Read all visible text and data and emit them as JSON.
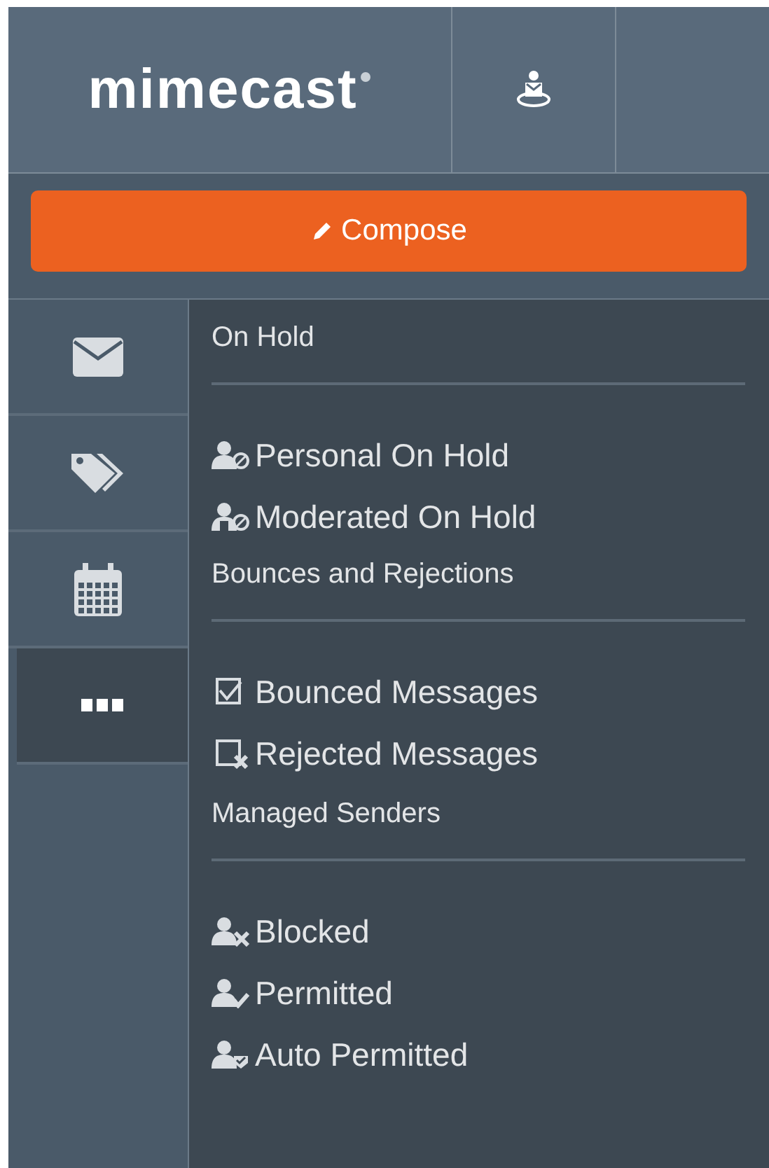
{
  "header": {
    "logo": "mimecast"
  },
  "compose": {
    "label": "Compose"
  },
  "nav": [
    {
      "kind": "mail",
      "selected": false
    },
    {
      "kind": "tags",
      "selected": false
    },
    {
      "kind": "calendar",
      "selected": false
    },
    {
      "kind": "more",
      "selected": true
    }
  ],
  "menu": [
    {
      "heading": "On Hold",
      "items": [
        {
          "kind": "personal",
          "label": "Personal On Hold"
        },
        {
          "kind": "moderated",
          "label": "Moderated On Hold"
        }
      ]
    },
    {
      "heading": "Bounces and Rejections",
      "items": [
        {
          "kind": "bounced",
          "label": "Bounced Messages"
        },
        {
          "kind": "rejected",
          "label": "Rejected Messages"
        }
      ]
    },
    {
      "heading": "Managed Senders",
      "items": [
        {
          "kind": "blocked",
          "label": "Blocked"
        },
        {
          "kind": "permitted",
          "label": "Permitted"
        },
        {
          "kind": "auto",
          "label": "Auto Permitted"
        }
      ]
    }
  ]
}
